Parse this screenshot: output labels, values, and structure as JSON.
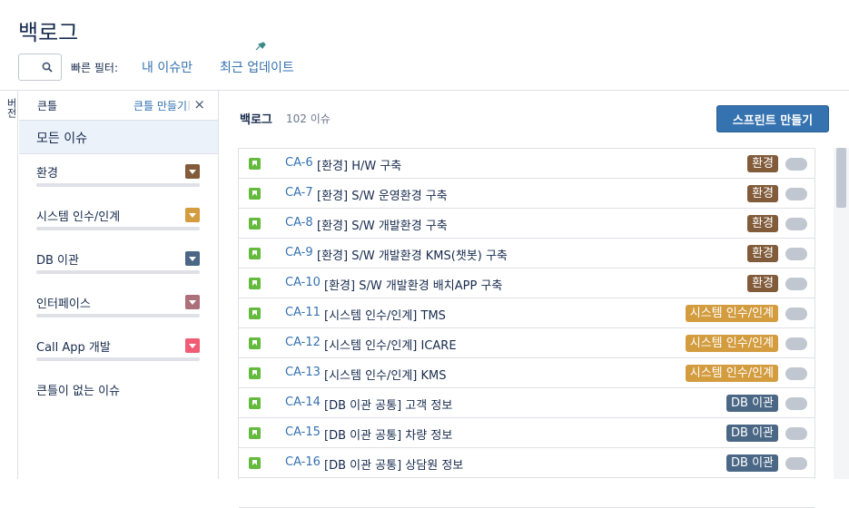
{
  "header": {
    "title": "백로그",
    "quick_filter_label": "빠른 필터:",
    "quick_filters": [
      "내 이슈만",
      "최근 업데이트"
    ]
  },
  "side_tab": {
    "label": "버전"
  },
  "epic_panel": {
    "heading": "큰틀",
    "create_label": "큰틀 만들기",
    "separator": "|",
    "close_glyph": "×",
    "all_issues": "모든 이슈",
    "epics": [
      {
        "name": "환경",
        "color": "#815b3a"
      },
      {
        "name": "시스템 인수/인계",
        "color": "#d39c3f"
      },
      {
        "name": "DB 이관",
        "color": "#4a6785"
      },
      {
        "name": "인터페이스",
        "color": "#ac707a"
      },
      {
        "name": "Call App 개발",
        "color": "#f15c75"
      }
    ],
    "no_epic": "큰틀이 없는 이슈"
  },
  "backlog": {
    "heading": "백로그",
    "count": "102 이슈",
    "create_sprint": "스프린트 만들기",
    "issues": [
      {
        "key": "CA-6",
        "summary": "[환경] H/W 구축",
        "epic": "환경",
        "color": "#815b3a"
      },
      {
        "key": "CA-7",
        "summary": "[환경] S/W 운영환경 구축",
        "epic": "환경",
        "color": "#815b3a"
      },
      {
        "key": "CA-8",
        "summary": "[환경] S/W 개발환경 구축",
        "epic": "환경",
        "color": "#815b3a"
      },
      {
        "key": "CA-9",
        "summary": "[환경] S/W 개발환경 KMS(챗봇) 구축",
        "epic": "환경",
        "color": "#815b3a"
      },
      {
        "key": "CA-10",
        "summary": "[환경] S/W 개발환경 배치APP 구축",
        "epic": "환경",
        "color": "#815b3a"
      },
      {
        "key": "CA-11",
        "summary": "[시스템 인수/인계] TMS",
        "epic": "시스템 인수/인계",
        "color": "#d39c3f"
      },
      {
        "key": "CA-12",
        "summary": "[시스템 인수/인계] ICARE",
        "epic": "시스템 인수/인계",
        "color": "#d39c3f"
      },
      {
        "key": "CA-13",
        "summary": "[시스템 인수/인계] KMS",
        "epic": "시스템 인수/인계",
        "color": "#d39c3f"
      },
      {
        "key": "CA-14",
        "summary": "[DB 이관 공통] 고객 정보",
        "epic": "DB 이관",
        "color": "#4a6785"
      },
      {
        "key": "CA-15",
        "summary": "[DB 이관 공통] 차량 정보",
        "epic": "DB 이관",
        "color": "#4a6785"
      },
      {
        "key": "CA-16",
        "summary": "[DB 이관 공통] 상담원 정보",
        "epic": "DB 이관",
        "color": "#4a6785"
      },
      {
        "key": "",
        "summary": "",
        "epic": "",
        "color": "#4a6785"
      }
    ]
  }
}
